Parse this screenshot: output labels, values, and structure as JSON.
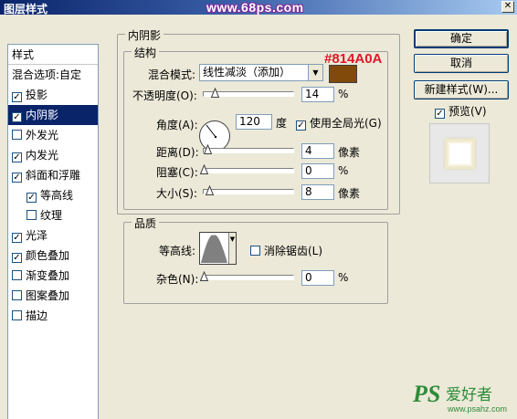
{
  "window": {
    "title": "图层样式",
    "watermark": "www.68ps.com",
    "close_glyph": "✕"
  },
  "sidebar": {
    "header": "样式",
    "blend_options": "混合选项:自定",
    "items": [
      {
        "label": "投影",
        "checked": true,
        "selected": false,
        "indent": false
      },
      {
        "label": "内阴影",
        "checked": true,
        "selected": true,
        "indent": false
      },
      {
        "label": "外发光",
        "checked": false,
        "selected": false,
        "indent": false
      },
      {
        "label": "内发光",
        "checked": true,
        "selected": false,
        "indent": false
      },
      {
        "label": "斜面和浮雕",
        "checked": true,
        "selected": false,
        "indent": false
      },
      {
        "label": "等高线",
        "checked": true,
        "selected": false,
        "indent": true
      },
      {
        "label": "纹理",
        "checked": false,
        "selected": false,
        "indent": true
      },
      {
        "label": "光泽",
        "checked": true,
        "selected": false,
        "indent": false
      },
      {
        "label": "颜色叠加",
        "checked": true,
        "selected": false,
        "indent": false
      },
      {
        "label": "渐变叠加",
        "checked": false,
        "selected": false,
        "indent": false
      },
      {
        "label": "图案叠加",
        "checked": false,
        "selected": false,
        "indent": false
      },
      {
        "label": "描边",
        "checked": false,
        "selected": false,
        "indent": false
      }
    ]
  },
  "panel": {
    "section_title": "内阴影",
    "structure": {
      "title": "结构",
      "blend_mode_label": "混合模式:",
      "blend_mode_value": "线性减淡（添加）",
      "color_hex_label": "#814A0A",
      "color": "#814a0a",
      "opacity_label": "不透明度(O):",
      "opacity_value": "14",
      "opacity_unit": "%",
      "angle_label": "角度(A):",
      "angle_value": "120",
      "angle_unit": "度",
      "global_light_label": "使用全局光(G)",
      "global_light_checked": true,
      "distance_label": "距离(D):",
      "distance_value": "4",
      "distance_unit": "像素",
      "choke_label": "阻塞(C):",
      "choke_value": "0",
      "choke_unit": "%",
      "size_label": "大小(S):",
      "size_value": "8",
      "size_unit": "像素"
    },
    "quality": {
      "title": "品质",
      "contour_label": "等高线:",
      "antialias_label": "消除锯齿(L)",
      "antialias_checked": false,
      "noise_label": "杂色(N):",
      "noise_value": "0",
      "noise_unit": "%"
    }
  },
  "buttons": {
    "ok": "确定",
    "cancel": "取消",
    "new_style": "新建样式(W)...",
    "preview_label": "预览(V)",
    "preview_checked": true
  },
  "logo": {
    "text": "PS爱好者",
    "url": "www.psahz.com"
  },
  "colors": {
    "accent": "#0a246a",
    "watermark_text": "#7a2e9a",
    "color_tag": "#e0162a"
  }
}
